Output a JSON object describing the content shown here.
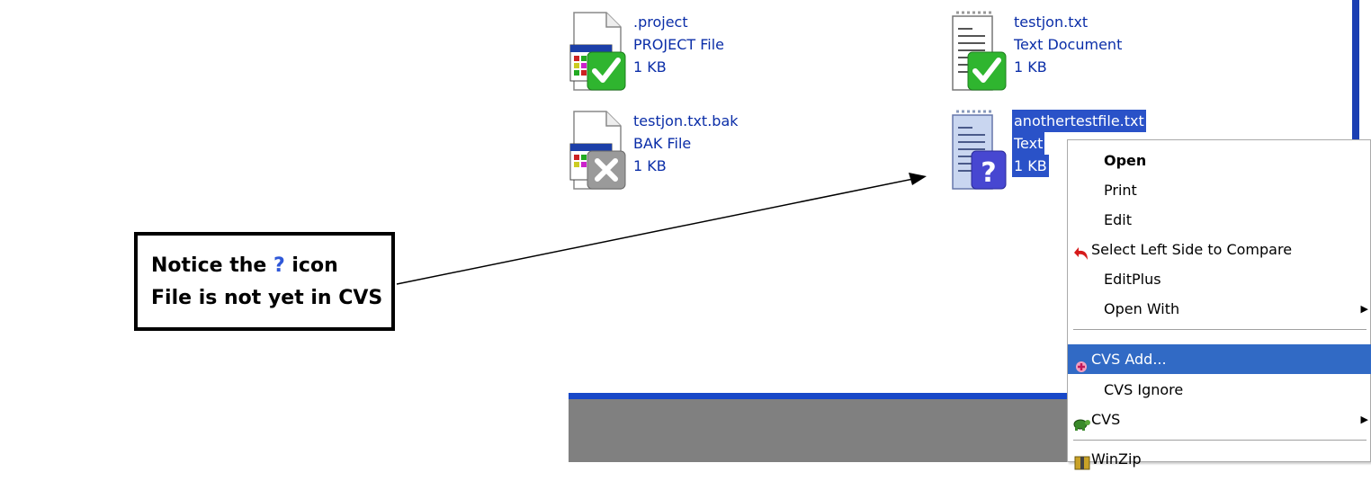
{
  "files": [
    {
      "name": ".project",
      "type": "PROJECT File",
      "size": "1 KB",
      "status": "in-cvs"
    },
    {
      "name": "testjon.txt",
      "type": "Text Document",
      "size": "1 KB",
      "status": "in-cvs"
    },
    {
      "name": "testjon.txt.bak",
      "type": "BAK File",
      "size": "1 KB",
      "status": "ignored"
    },
    {
      "name": "anothertestfile.txt",
      "type": "Text",
      "size": "1 KB",
      "status": "unversioned"
    }
  ],
  "callout": {
    "line1_prefix": "Notice the ",
    "line1_symbol": "?",
    "line1_suffix": " icon",
    "line2": "File is not yet in CVS"
  },
  "menu": {
    "items": [
      {
        "label": "Open"
      },
      {
        "label": "Print"
      },
      {
        "label": "Edit"
      },
      {
        "label": "Select Left Side to Compare",
        "icon": "undo-arrow-icon"
      },
      {
        "label": "EditPlus"
      },
      {
        "label": "Open With"
      },
      {
        "label": "CVS Add...",
        "icon": "plus-icon"
      },
      {
        "label": "CVS Ignore"
      },
      {
        "label": "CVS",
        "icon": "turtle-icon"
      },
      {
        "label": "WinZip"
      }
    ]
  },
  "colors": {
    "selection": "#316ac5",
    "link_text": "#0b2ea8",
    "window_border": "#1b3fb3",
    "check_green": "#2fb52f",
    "question_blue": "#4747d1"
  }
}
